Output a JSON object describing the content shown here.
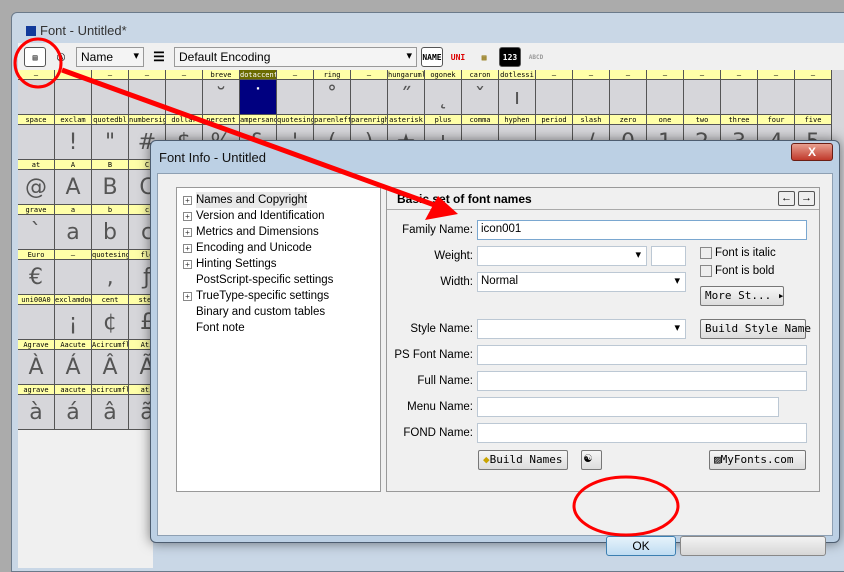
{
  "window": {
    "title": "Font - Untitled*"
  },
  "toolbar": {
    "view_select": "Name",
    "encoding_select": "Default Encoding",
    "btn_name": "NAME",
    "btn_uni": "UNI",
    "btn_123": "123",
    "btn_abcd": "ABCD"
  },
  "grid": {
    "selected": "dotaccent",
    "rows": [
      {
        "labels": [
          "—",
          "—",
          "—",
          "—",
          "—",
          "breve",
          "dotaccent",
          "—",
          "ring",
          "—",
          "hungaruml",
          "ogonek",
          "caron",
          "dotlessi",
          "—",
          "—",
          "—",
          "—",
          "—",
          "—",
          "—",
          "—"
        ],
        "glyphs": [
          "",
          "",
          "",
          "",
          "",
          "˘",
          "˙",
          "",
          "˚",
          "",
          "˝",
          "˛",
          "ˇ",
          "ı",
          "",
          "",
          "",
          "",
          "",
          "",
          "",
          ""
        ]
      },
      {
        "labels": [
          "space",
          "exclam",
          "quotedbl",
          "numbersig",
          "dollar",
          "percent",
          "ampersand",
          "quotesing",
          "parenleft",
          "parenrigh",
          "asterisk",
          "plus",
          "comma",
          "hyphen",
          "period",
          "slash",
          "zero",
          "one",
          "two",
          "three",
          "four",
          "five"
        ],
        "glyphs": [
          "",
          "!",
          "\"",
          "#",
          "$",
          "%",
          "&",
          "'",
          "(",
          ")",
          "★",
          "+",
          ",",
          "-",
          ".",
          "/",
          "0",
          "1",
          "2",
          "3",
          "4",
          "5"
        ]
      },
      {
        "labels": [
          "at",
          "A",
          "B",
          "C"
        ],
        "glyphs": [
          "@",
          "A",
          "B",
          "C"
        ]
      },
      {
        "labels": [
          "grave",
          "a",
          "b",
          "c"
        ],
        "glyphs": [
          "`",
          "a",
          "b",
          "c"
        ]
      },
      {
        "labels": [
          "Euro",
          "—",
          "quotesing",
          "flo"
        ],
        "glyphs": [
          "€",
          "",
          "‚",
          "ƒ"
        ]
      },
      {
        "labels": [
          "uni00A0",
          "exclamdow",
          "cent",
          "ster"
        ],
        "glyphs": [
          "",
          "¡",
          "¢",
          "£"
        ]
      },
      {
        "labels": [
          "Agrave",
          "Aacute",
          "Acircumfl",
          "Ati"
        ],
        "glyphs": [
          "À",
          "Á",
          "Â",
          "Ã"
        ]
      },
      {
        "labels": [
          "agrave",
          "aacute",
          "acircumfl",
          "ati"
        ],
        "glyphs": [
          "à",
          "á",
          "â",
          "ã"
        ]
      }
    ]
  },
  "dialog": {
    "title": "Font Info - Untitled",
    "close": "X",
    "tree": [
      {
        "label": "Names and Copyright",
        "exp": true
      },
      {
        "label": "Version and Identification",
        "exp": true
      },
      {
        "label": "Metrics and Dimensions",
        "exp": true
      },
      {
        "label": "Encoding and Unicode",
        "exp": true
      },
      {
        "label": "Hinting Settings",
        "exp": true
      },
      {
        "label": "PostScript-specific settings",
        "exp": false
      },
      {
        "label": "TrueType-specific settings",
        "exp": true
      },
      {
        "label": "Binary and custom tables",
        "exp": false
      },
      {
        "label": "Font note",
        "exp": false
      }
    ],
    "section_title": "Basic set of font names",
    "prev": "←",
    "next": "→",
    "family_label": "Family Name:",
    "family_value": "icon001",
    "weight_label": "Weight:",
    "weight_value": "",
    "weight_num": "",
    "width_label": "Width:",
    "width_value": "Normal",
    "italic_label": "Font is italic",
    "bold_label": "Font is bold",
    "more_styles": "More St...  ▸",
    "style_label": "Style Name:",
    "build_style": "Build Style Name",
    "ps_label": "PS Font Name:",
    "full_label": "Full Name:",
    "menu_label": "Menu Name:",
    "fond_label": "FOND Name:",
    "build_names": "Build Names",
    "yinyang": "☯",
    "myfonts": "MyFonts.com",
    "ok": "OK",
    "cancel": ""
  },
  "annotation_color": "#ff0000"
}
